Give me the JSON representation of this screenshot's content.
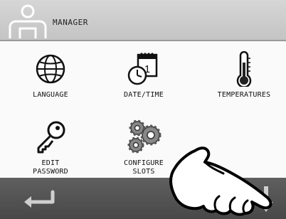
{
  "header": {
    "title": "MANAGER",
    "user_icon": "user-icon"
  },
  "menu": {
    "items": [
      {
        "label": "LANGUAGE",
        "icon": "globe-icon"
      },
      {
        "label": "DATE/TIME",
        "icon": "calendar-clock-icon"
      },
      {
        "label": "TEMPERATURES",
        "icon": "thermometer-icon"
      },
      {
        "label": "EDIT\nPASSWORD",
        "icon": "key-icon"
      },
      {
        "label": "CONFIGURE\nSLOTS",
        "icon": "gears-icon"
      }
    ],
    "calendar_day": "1"
  },
  "footer": {
    "back_icon": "back-arrow-icon",
    "scroll_icon": "down-arrow-icon"
  },
  "overlay": {
    "icon": "pointing-hand-icon"
  },
  "colors": {
    "header_bg": "#c8c8c8",
    "content_bg": "#fafafa",
    "footer_bg": "#555555"
  }
}
